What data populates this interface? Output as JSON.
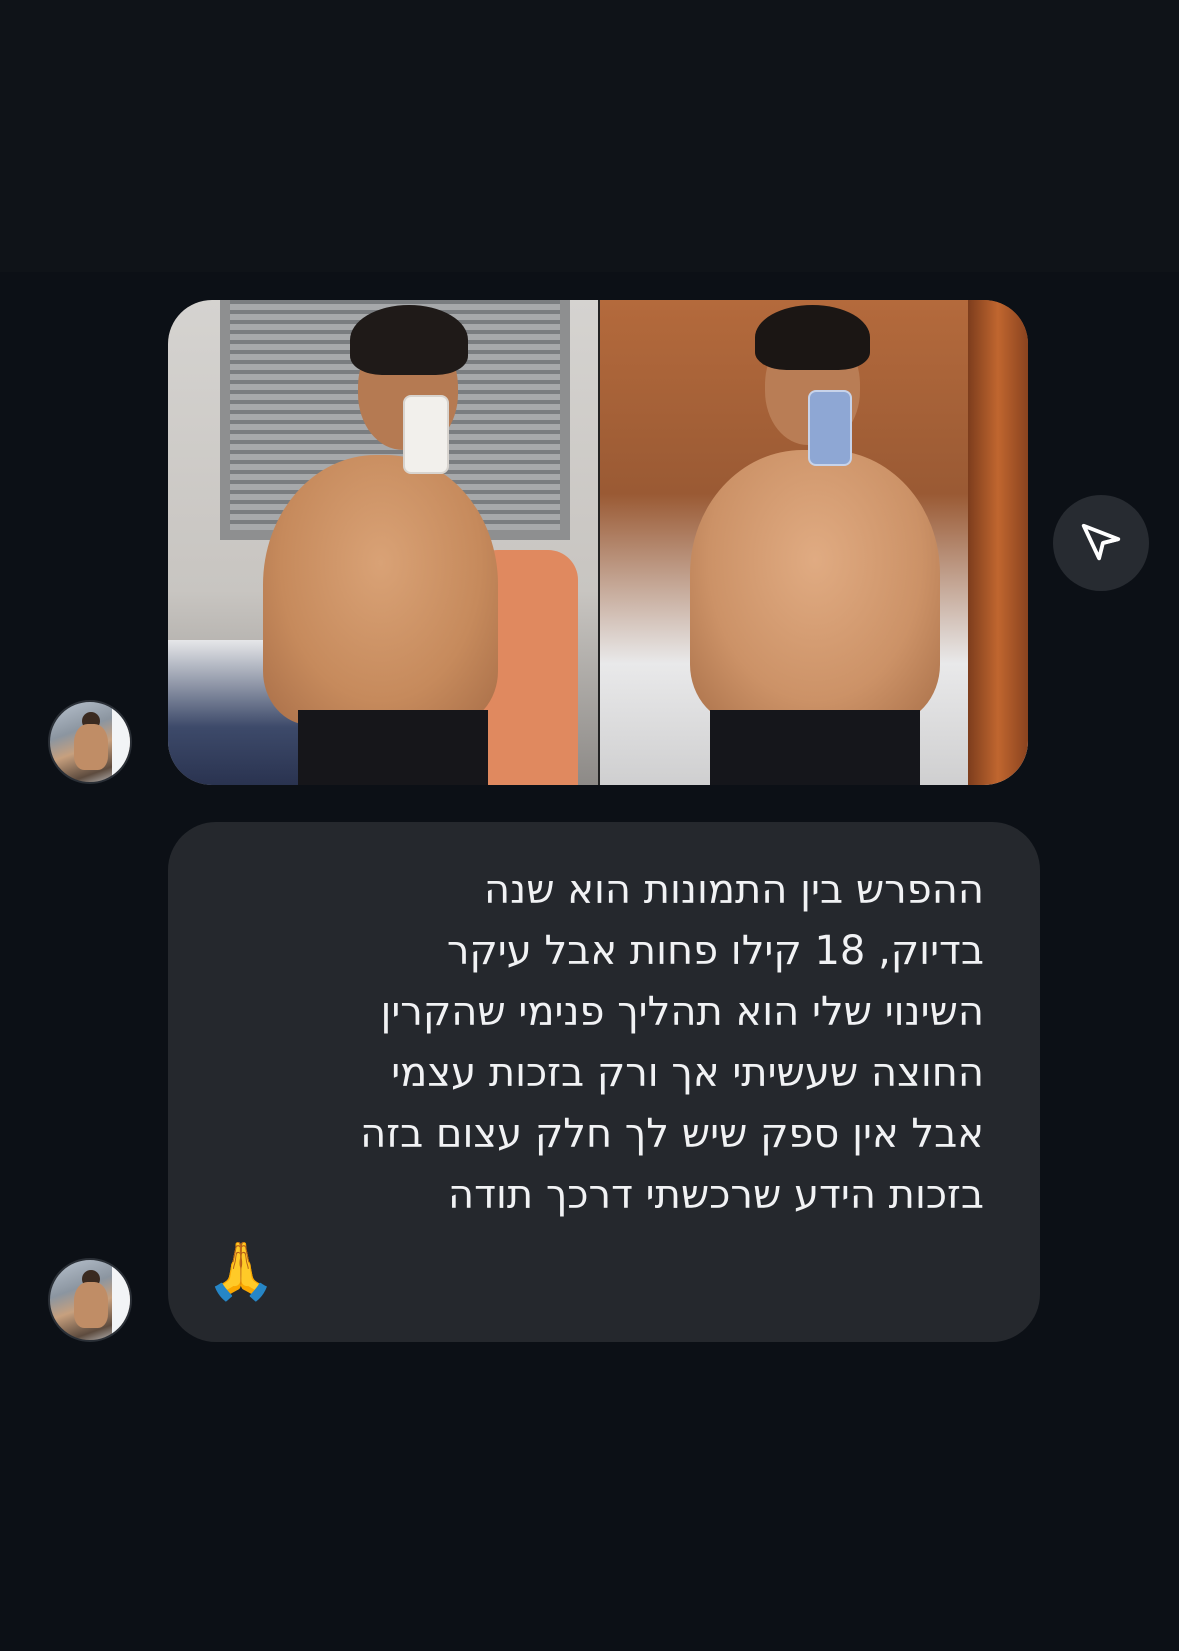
{
  "message": {
    "lines": [
      "ההפרש בין התמונות הוא שנה",
      "בדיוק,  18 קילו פחות אבל עיקר",
      "השינוי שלי הוא תהליך פנימי שהקרין",
      "החוצה שעשיתי אך ורק בזכות עצמי",
      "אבל אין ספק שיש לך חלק עצום בזה",
      "בזכות הידע שרכשתי דרכך תודה"
    ],
    "emoji": "🙏"
  },
  "colors": {
    "background": "#0c1016",
    "top_band": "#0f1318",
    "bubble": "#25282d",
    "text": "#f1f2f4",
    "share_button": "#272b31"
  },
  "icons": {
    "share": "send-paper-plane-icon"
  }
}
